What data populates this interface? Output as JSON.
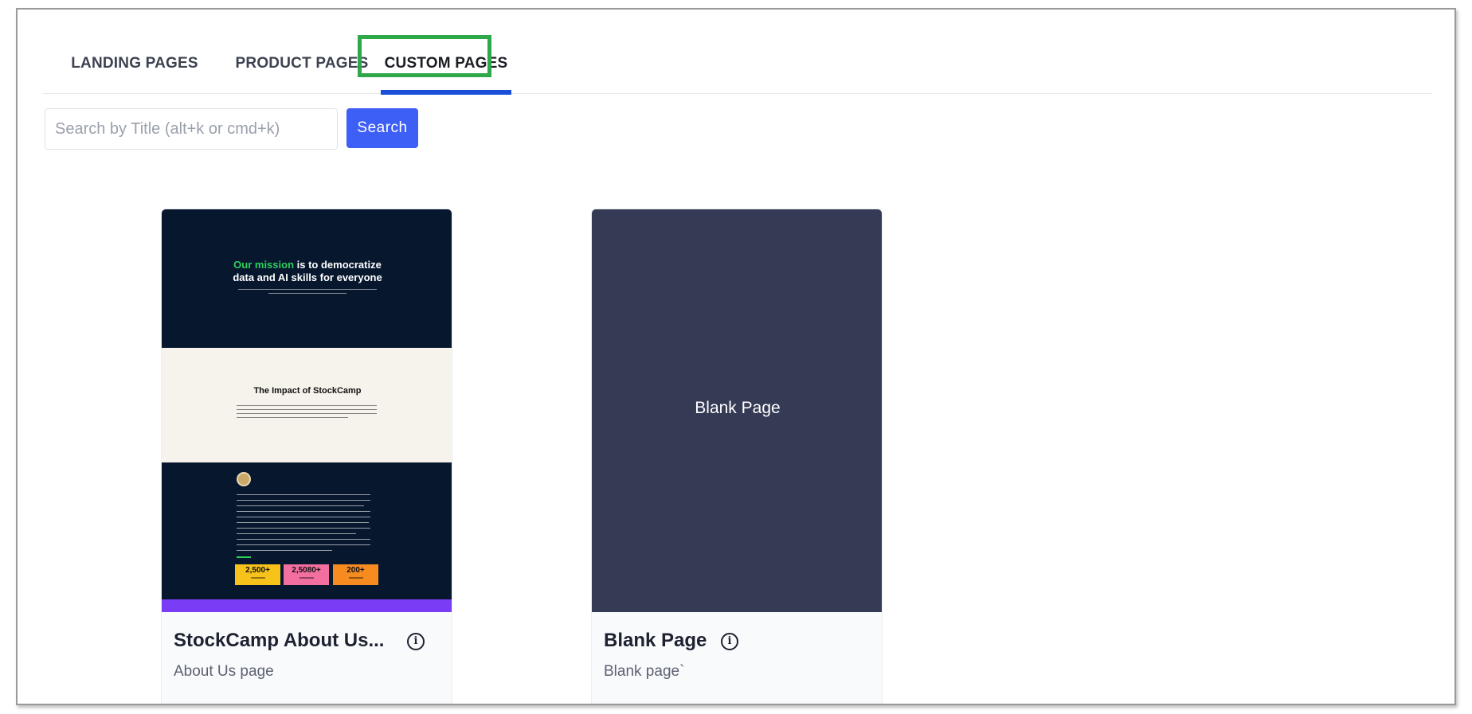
{
  "tabs": [
    {
      "label": "LANDING PAGES"
    },
    {
      "label": "PRODUCT PAGES"
    },
    {
      "label": "CUSTOM PAGES",
      "active": true
    }
  ],
  "search": {
    "placeholder": "Search by Title (alt+k or cmd+k)",
    "value": "",
    "button_label": "Search"
  },
  "cards": [
    {
      "title": "StockCamp About Us...",
      "subtitle": "About Us page",
      "info_icon": "info-circle-icon",
      "preview": {
        "headline_accent": "Our mission",
        "headline_rest": " is to democratize",
        "headline_line2": "data and AI skills for everyone",
        "impact_title": "The Impact of StockCamp",
        "stats": [
          "2,500+",
          "2,5080+",
          "200+"
        ]
      }
    },
    {
      "title": "Blank Page",
      "subtitle": "Blank page`",
      "info_icon": "info-circle-icon",
      "preview": {
        "label": "Blank Page"
      }
    }
  ],
  "colors": {
    "active_tab_underline": "#1c4fd8",
    "highlight_box": "#2ea84a",
    "search_button": "#3e5ff5",
    "blank_thumb": "#353b55",
    "stockcamp_dark": "#06172e",
    "stockcamp_accent": "#2fd05a"
  }
}
